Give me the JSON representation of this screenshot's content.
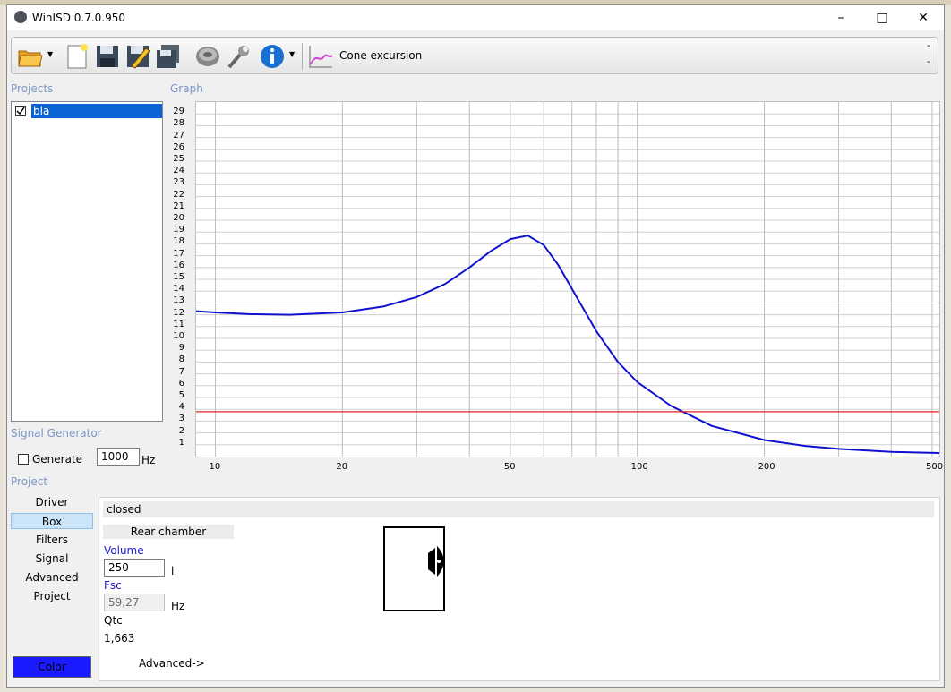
{
  "window": {
    "title": "WinISD 0.7.0.950"
  },
  "toolbar": {
    "graph_selector": "Cone excursion",
    "right_marks": [
      "-",
      "-"
    ]
  },
  "projects": {
    "label": "Projects",
    "items": [
      {
        "name": "bla",
        "checked": true
      }
    ]
  },
  "graph": {
    "label": "Graph",
    "ylabels": [
      "29",
      "28",
      "27",
      "26",
      "25",
      "24",
      "23",
      "22",
      "21",
      "20",
      "19",
      "18",
      "17",
      "16",
      "15",
      "14",
      "13",
      "12",
      "11",
      "10",
      "9",
      "8",
      "7",
      "6",
      "5",
      "4",
      "3",
      "2",
      "1"
    ],
    "xlabels": [
      "10",
      "20",
      "50",
      "100",
      "200",
      "500"
    ]
  },
  "signal_generator": {
    "label": "Signal Generator",
    "generate_label": "Generate",
    "freq_value": "1000",
    "unit": "Hz"
  },
  "project_section": {
    "label": "Project",
    "nav": [
      "Driver",
      "Box",
      "Filters",
      "Signal",
      "Advanced",
      "Project"
    ],
    "active": "Box",
    "color_button": "Color"
  },
  "box": {
    "type": "closed",
    "rear_chamber": "Rear chamber",
    "volume_label": "Volume",
    "volume_value": "250",
    "volume_unit": "l",
    "fsc_label": "Fsc",
    "fsc_value": "59,27",
    "fsc_unit": "Hz",
    "qtc_label": "Qtc",
    "qtc_value": "1,663",
    "advanced": "Advanced->"
  },
  "colors": {
    "curve": "#1010d0",
    "limit": "#e02020",
    "selected": "#0a64d6",
    "color_btn": "#1a1aff",
    "section": "#7b96c6"
  },
  "chart_data": {
    "type": "line",
    "xscale": "log",
    "xlim": [
      9,
      520
    ],
    "ylim": [
      0,
      30
    ],
    "x": [
      9,
      10,
      12,
      15,
      20,
      25,
      30,
      35,
      40,
      45,
      50,
      55,
      60,
      65,
      70,
      80,
      90,
      100,
      120,
      150,
      200,
      250,
      300,
      400,
      520
    ],
    "series": [
      {
        "values": [
          12.3,
          12.2,
          12.05,
          12.0,
          12.2,
          12.7,
          13.5,
          14.6,
          16.0,
          17.4,
          18.4,
          18.7,
          17.9,
          16.2,
          14.2,
          10.6,
          8.0,
          6.3,
          4.3,
          2.6,
          1.4,
          0.9,
          0.65,
          0.4,
          0.3
        ]
      },
      {
        "values": [
          3.8,
          3.8
        ],
        "x": [
          9,
          520
        ]
      }
    ]
  }
}
